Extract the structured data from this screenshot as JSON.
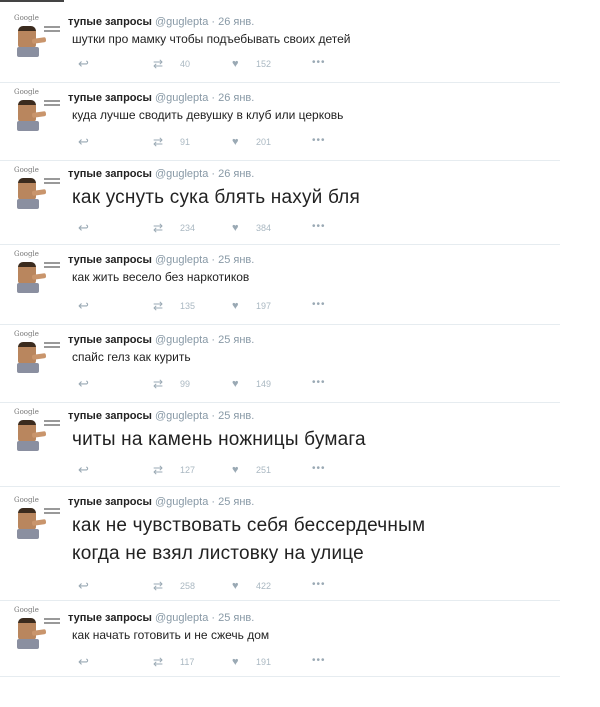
{
  "tweets": [
    {
      "name": "тупые запросы",
      "handle": "@guglepta",
      "date": "· 26 янв.",
      "text": "шутки про мамку чтобы подъебывать своих детей",
      "retweets": "40",
      "likes": "152"
    },
    {
      "name": "тупые запросы",
      "handle": "@guglepta",
      "date": "· 26 янв.",
      "text": "куда лучше сводить девушку в клуб или церковь",
      "retweets": "91",
      "likes": "201"
    },
    {
      "name": "тупые запросы",
      "handle": "@guglepta",
      "date": "· 26 янв.",
      "text": "как уснуть сука блять нахуй бля",
      "retweets": "234",
      "likes": "384"
    },
    {
      "name": "тупые запросы",
      "handle": "@guglepta",
      "date": "· 25 янв.",
      "text": "как жить весело без наркотиков",
      "retweets": "135",
      "likes": "197"
    },
    {
      "name": "тупые запросы",
      "handle": "@guglepta",
      "date": "· 25 янв.",
      "text": "спайс гелз как курить",
      "retweets": "99",
      "likes": "149"
    },
    {
      "name": "тупые запросы",
      "handle": "@guglepta",
      "date": "· 25 янв.",
      "text": "читы на камень ножницы бумага",
      "retweets": "127",
      "likes": "251"
    },
    {
      "name": "тупые запросы",
      "handle": "@guglepta",
      "date": "· 25 янв.",
      "text_line1": "как не чувствовать себя бессердечным",
      "text_line2": "когда не взял листовку на улице",
      "retweets": "258",
      "likes": "422"
    },
    {
      "name": "тупые запросы",
      "handle": "@guglepta",
      "date": "· 25 янв.",
      "text": "как начать готовить и не сжечь дом",
      "retweets": "117",
      "likes": "191"
    }
  ],
  "avatar_label": "Google",
  "icons": {
    "reply": "reply-icon",
    "retweet": "retweet-icon",
    "like": "heart-icon",
    "more": "more-icon"
  }
}
